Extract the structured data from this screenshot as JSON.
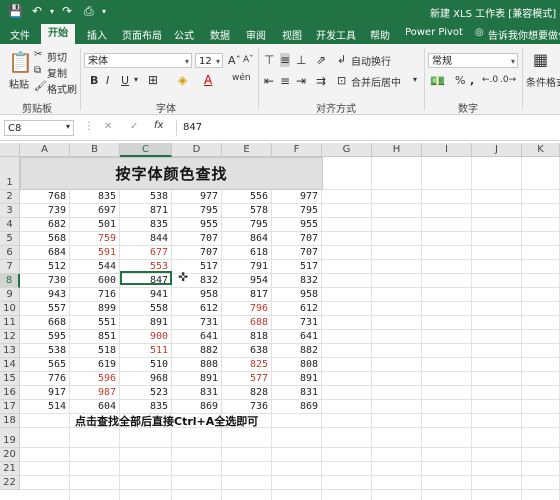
{
  "titlebar": {
    "doc_title": "新建 XLS 工作表 [兼容模式] - E",
    "save_icon": "save-icon",
    "undo_icon": "undo-icon",
    "redo_icon": "redo-icon",
    "preview_icon": "print-preview-icon"
  },
  "tabs": [
    "文件",
    "开始",
    "插入",
    "页面布局",
    "公式",
    "数据",
    "审阅",
    "视图",
    "开发工具",
    "帮助",
    "Power Pivot"
  ],
  "active_tab": "开始",
  "tell_me": "告诉我你想要做什么",
  "ribbon": {
    "clipboard": {
      "paste": "粘贴",
      "cut": "剪切",
      "copy": "复制",
      "format_painter": "格式刷",
      "label": "剪贴板"
    },
    "font": {
      "name": "宋体",
      "size": "12",
      "bold": "B",
      "italic": "I",
      "underline": "U",
      "wen": "wén",
      "label": "字体"
    },
    "alignment": {
      "wrap": "自动换行",
      "merge": "合并后居中",
      "label": "对齐方式"
    },
    "number": {
      "format": "常规",
      "percent": "%",
      "comma": ",",
      "label": "数字"
    },
    "styles": {
      "conditional": "条件格式"
    }
  },
  "formula_bar": {
    "name_box": "C8",
    "cancel": "✕",
    "enter": "✓",
    "fx": "fx",
    "value": "847"
  },
  "columns": [
    "A",
    "B",
    "C",
    "D",
    "E",
    "F",
    "G",
    "H",
    "I",
    "J",
    "K"
  ],
  "selected_column": "C",
  "selected_row": 8,
  "rows": [
    "1",
    "2",
    "3",
    "4",
    "5",
    "6",
    "7",
    "8",
    "9",
    "10",
    "11",
    "12",
    "13",
    "14",
    "15",
    "16",
    "17",
    "18",
    "19",
    "20",
    "21",
    "22"
  ],
  "sheet_title": "按字体颜色查找",
  "note": "点击查找全部后直接Ctrl+A全选即可",
  "red_color": "#c0392b",
  "data": [
    [
      "768",
      "835",
      "538",
      "977",
      "556",
      "977"
    ],
    [
      "739",
      "697",
      "871",
      "795",
      "578",
      "795"
    ],
    [
      "682",
      "501",
      "835",
      "955",
      "795",
      "955"
    ],
    [
      "568",
      "759",
      "844",
      "707",
      "864",
      "707"
    ],
    [
      "684",
      "591",
      "677",
      "707",
      "618",
      "707"
    ],
    [
      "512",
      "544",
      "553",
      "517",
      "791",
      "517"
    ],
    [
      "730",
      "600",
      "847",
      "832",
      "954",
      "832"
    ],
    [
      "943",
      "716",
      "941",
      "958",
      "817",
      "958"
    ],
    [
      "557",
      "899",
      "558",
      "612",
      "796",
      "612"
    ],
    [
      "668",
      "551",
      "891",
      "731",
      "688",
      "731"
    ],
    [
      "595",
      "851",
      "900",
      "641",
      "818",
      "641"
    ],
    [
      "538",
      "518",
      "511",
      "882",
      "638",
      "882"
    ],
    [
      "565",
      "619",
      "510",
      "808",
      "825",
      "808"
    ],
    [
      "776",
      "596",
      "968",
      "891",
      "577",
      "891"
    ],
    [
      "917",
      "987",
      "523",
      "831",
      "828",
      "831"
    ],
    [
      "514",
      "604",
      "835",
      "869",
      "736",
      "869"
    ]
  ],
  "red_cells": [
    [
      3,
      1
    ],
    [
      4,
      1
    ],
    [
      4,
      2
    ],
    [
      5,
      2
    ],
    [
      8,
      4
    ],
    [
      9,
      4
    ],
    [
      10,
      2
    ],
    [
      11,
      2
    ],
    [
      12,
      4
    ],
    [
      13,
      1
    ],
    [
      13,
      4
    ],
    [
      14,
      1
    ]
  ]
}
